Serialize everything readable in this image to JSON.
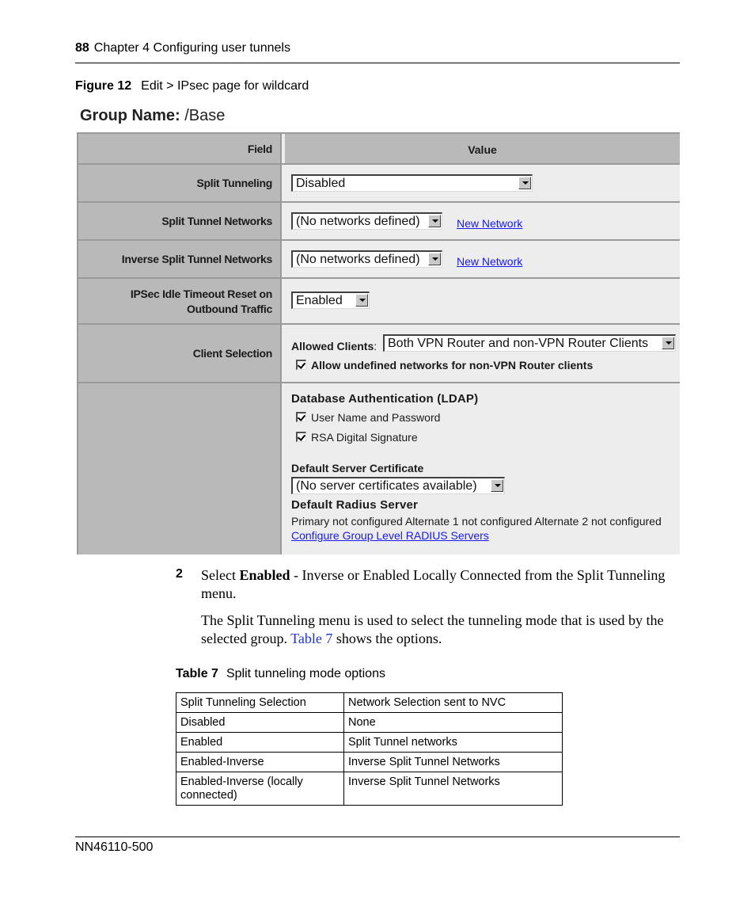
{
  "header": {
    "page_number": "88",
    "chapter": "Chapter 4  Configuring user tunnels"
  },
  "figure": {
    "label": "Figure 12",
    "caption": "Edit > IPsec page for wildcard"
  },
  "ui": {
    "group_name_label": "Group Name:",
    "group_name_value": "/Base",
    "columns": {
      "field": "Field",
      "value": "Value"
    },
    "split_tunneling": {
      "label": "Split Tunneling",
      "selected": "Disabled"
    },
    "split_tunnel_networks": {
      "label": "Split Tunnel Networks",
      "selected": "(No networks defined)",
      "link": "New Network"
    },
    "inverse_split_tunnel_networks": {
      "label": "Inverse Split Tunnel Networks",
      "selected": "(No networks defined)",
      "link": "New Network"
    },
    "ipsec_idle_timeout": {
      "label_line1": "IPSec Idle Timeout Reset on",
      "label_line2": "Outbound Traffic",
      "selected": "Enabled"
    },
    "client_selection": {
      "label": "Client Selection",
      "allowed_clients_label": "Allowed Clients",
      "allowed_clients_colon": ":",
      "allowed_clients_selected": "Both VPN Router and non-VPN Router Clients",
      "allow_undefined_label": "Allow undefined networks for non-VPN Router clients",
      "allow_undefined_checked": true
    },
    "auth": {
      "ldap_title": "Database Authentication (LDAP)",
      "user_password_label": "User Name and Password",
      "user_password_checked": true,
      "rsa_label": "RSA Digital Signature",
      "rsa_checked": true,
      "cert_title": "Default Server Certificate",
      "cert_selected": "(No server certificates available)",
      "radius_title": "Default Radius Server",
      "radius_status": "Primary not configured Alternate 1 not configured Alternate 2 not configured",
      "radius_link": "Configure Group Level RADIUS Servers"
    }
  },
  "step": {
    "number": "2",
    "pre": "Select ",
    "bold": "Enabled",
    "post": " - Inverse or Enabled Locally Connected from the Split Tunneling menu."
  },
  "paragraph": {
    "pre": "The Split Tunneling menu is used to select the tunneling mode that is used by the selected group. ",
    "ref": "Table 7",
    "post": " shows the options."
  },
  "table": {
    "label": "Table 7",
    "caption": "Split tunneling mode options",
    "header": [
      "Split Tunneling Selection",
      "Network Selection sent to NVC"
    ],
    "rows": [
      [
        "Disabled",
        "None"
      ],
      [
        "Enabled",
        "Split Tunnel networks"
      ],
      [
        "Enabled-Inverse",
        "Inverse Split Tunnel Networks"
      ],
      [
        "Enabled-Inverse (locally connected)",
        "Inverse Split Tunnel Networks"
      ]
    ]
  },
  "footer": {
    "doc_number": "NN46110-500"
  }
}
